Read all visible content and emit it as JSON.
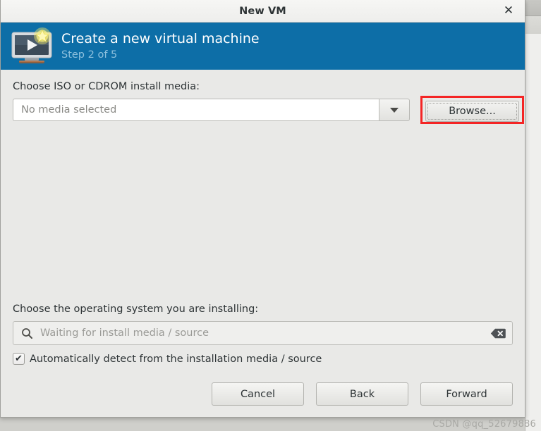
{
  "window": {
    "title": "New VM",
    "close_label": "✕"
  },
  "header": {
    "title": "Create a new virtual machine",
    "step": "Step 2 of 5",
    "icon": "new-virtual-machine-icon",
    "background_color": "#0d6ea7",
    "step_color": "#8dc0dd"
  },
  "media": {
    "label": "Choose ISO or CDROM install media:",
    "entry_value": "No media selected",
    "dropdown_icon": "chevron-down-icon",
    "browse_label": "Browse...",
    "highlight_color": "#f42525"
  },
  "os": {
    "label": "Choose the operating system you are installing:",
    "search_icon": "search-icon",
    "search_placeholder": "Waiting for install media / source",
    "clear_icon": "backspace-clear-icon",
    "autodetect_label": "Automatically detect from the installation media / source",
    "autodetect_checked": true,
    "check_glyph": "✔"
  },
  "actions": {
    "cancel": "Cancel",
    "back": "Back",
    "forward": "Forward"
  },
  "watermark": {
    "text": "CSDN @qq_52679886"
  }
}
